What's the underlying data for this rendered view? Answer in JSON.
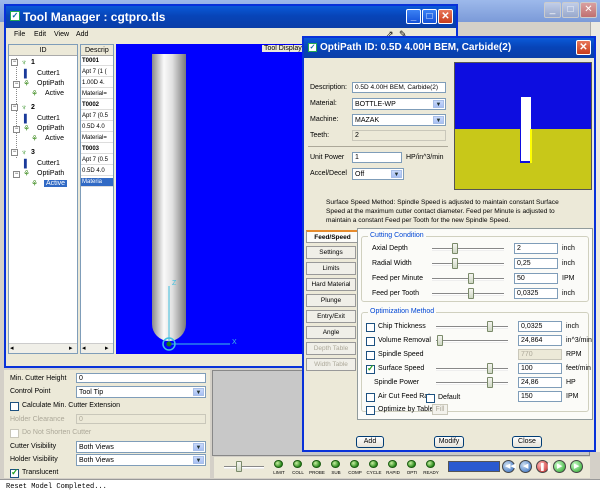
{
  "background_window": {
    "title": "",
    "min": "_",
    "max": "□",
    "close": "✕"
  },
  "tool_manager": {
    "title": "Tool Manager : cgtpro.tls",
    "menu": [
      "File",
      "Edit",
      "View",
      "Add"
    ],
    "tree_header": "ID",
    "desc_header": "Descrip",
    "tool_display_label": "Tool Display",
    "tree": [
      {
        "num": "1",
        "cutter": "Cutter1",
        "optipath": "OptiPath",
        "active": "Active"
      },
      {
        "num": "2",
        "cutter": "Cutter1",
        "optipath": "OptiPath",
        "active": "Active"
      },
      {
        "num": "3",
        "cutter": "Cutter1",
        "optipath": "OptiPath",
        "active": "Active"
      }
    ],
    "desc_rows": [
      "T0001",
      "Apt 7 (1 (",
      "1.00D 4.",
      "Material=",
      "T0002",
      "Apt 7 (0.5",
      "0.5D 4.0",
      "Material=",
      "T0003",
      "Apt 7 (0.5",
      "0.5D 4.0",
      "Materia"
    ],
    "axis_z": "Z",
    "axis_x": "X"
  },
  "lower_panel": {
    "min_cutter_height": "Min. Cutter Height",
    "min_cutter_height_value": "0",
    "control_point_label": "Control Point",
    "control_point_value": "Tool Tip",
    "calc_min_ext": "Calculate Min. Cutter Extension",
    "holder_clearance_label": "Holder Clearance",
    "holder_clearance_value": "0",
    "do_not_shorten": "Do Not Shorten Cutter",
    "cutter_visibility_label": "Cutter Visibility",
    "cutter_visibility_value": "Both Views",
    "holder_visibility_label": "Holder Visibility",
    "holder_visibility_value": "Both Views",
    "translucent": "Translucent"
  },
  "status": {
    "message": "Reset Model Completed...",
    "leds": [
      "LIMIT",
      "COLL",
      "PROBE",
      "SUB",
      "COMP",
      "CYCLE",
      "RAPID",
      "OPTI",
      "READY"
    ]
  },
  "optipath": {
    "title": "OptiPath ID: 0.5D 4.00H BEM, Carbide(2)",
    "description_label": "Description:",
    "description_value": "0.5D 4.00H BEM, Carbide(2)",
    "material_label": "Material:",
    "material_value": "BOTTLE-WP",
    "machine_label": "Machine:",
    "machine_value": "MAZAK",
    "teeth_label": "Teeth:",
    "teeth_value": "2",
    "unit_power_label": "Unit Power",
    "unit_power_value": "1",
    "unit_power_unit": "HP/in^3/min",
    "accel_label": "Accel/Decel",
    "accel_value": "Off",
    "method_text": "Surface Speed Method: Spindle Speed is adjusted to maintain constant Surface Speed at the maximum cutter contact diameter. Feed per Minute is adjusted to maintain a constant Feed per Tooth for the new Spindle Speed.",
    "tabs": [
      "Feed/Speed",
      "Settings",
      "Limits",
      "Hard Material",
      "Plunge",
      "Entry/Exit",
      "Angle",
      "Depth Table",
      "Width Table"
    ],
    "cutting_condition_title": "Cutting Condition",
    "cutting": [
      {
        "label": "Axial Depth",
        "value": "2",
        "unit": "inch",
        "pos": 0.3
      },
      {
        "label": "Radial Width",
        "value": "0,25",
        "unit": "inch",
        "pos": 0.3
      },
      {
        "label": "Feed per Minute",
        "value": "50",
        "unit": "IPM",
        "pos": 0.55
      },
      {
        "label": "Feed per Tooth",
        "value": "0,0325",
        "unit": "inch",
        "pos": 0.55
      }
    ],
    "optimization_title": "Optimization Method",
    "optimization": [
      {
        "label": "Chip Thickness",
        "value": "0,0325",
        "unit": "inch",
        "checked": false,
        "pos": 0.77
      },
      {
        "label": "Volume Removal",
        "value": "24,864",
        "unit": "in^3/min",
        "checked": false,
        "pos": 0.02
      },
      {
        "label": "Spindle Speed",
        "value": "770",
        "unit": "RPM",
        "checked": false,
        "pos": null
      },
      {
        "label": "Surface Speed",
        "value": "100",
        "unit": "feet/min",
        "checked": true,
        "pos": 0.77
      },
      {
        "label": "Spindle Power",
        "value": "24,86",
        "unit": "HP",
        "checked": null,
        "pos": 0.77
      },
      {
        "label": "Air Cut Feed Rate",
        "value": "150",
        "unit": "IPM",
        "checked": false,
        "pos": null
      }
    ],
    "default_label": "Default",
    "optimize_by_tables": "Optimize by Tables",
    "fill_label": "Fill",
    "add_button": "Add",
    "modify_button": "Modify",
    "close_button": "Close",
    "colors": {
      "preview_bg": "#0d0de0",
      "material": "#c8c819",
      "cut_edge": "#ffff00"
    }
  }
}
